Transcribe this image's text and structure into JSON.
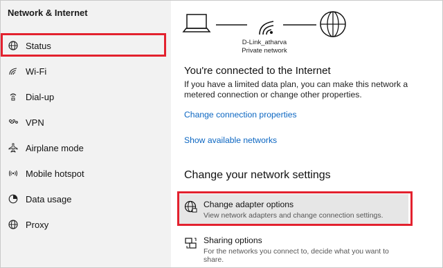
{
  "sidebar": {
    "title": "Network & Internet",
    "items": [
      {
        "label": "Status",
        "icon": "globe-icon"
      },
      {
        "label": "Wi-Fi",
        "icon": "wifi-icon"
      },
      {
        "label": "Dial-up",
        "icon": "dialup-icon"
      },
      {
        "label": "VPN",
        "icon": "vpn-icon"
      },
      {
        "label": "Airplane mode",
        "icon": "airplane-icon"
      },
      {
        "label": "Mobile hotspot",
        "icon": "hotspot-icon"
      },
      {
        "label": "Data usage",
        "icon": "data-usage-icon"
      },
      {
        "label": "Proxy",
        "icon": "proxy-globe-icon"
      }
    ]
  },
  "main": {
    "network_name": "D-Link_atharva",
    "network_type": "Private network",
    "connected_heading": "You're connected to the Internet",
    "connected_desc": "If you have a limited data plan, you can make this network a metered connection or change other properties.",
    "links": {
      "change_connection": "Change connection properties",
      "show_networks": "Show available networks"
    },
    "settings_heading": "Change your network settings",
    "options": [
      {
        "title": "Change adapter options",
        "subtitle": "View network adapters and change connection settings.",
        "icon": "adapter-globe-icon"
      },
      {
        "title": "Sharing options",
        "subtitle": "For the networks you connect to, decide what you want to share.",
        "icon": "sharing-icon"
      }
    ]
  },
  "colors": {
    "highlight": "#e3212e",
    "link": "#0b66c2",
    "sidebar_bg": "#f2f2f2",
    "selected_bg": "#e6e6e6"
  }
}
